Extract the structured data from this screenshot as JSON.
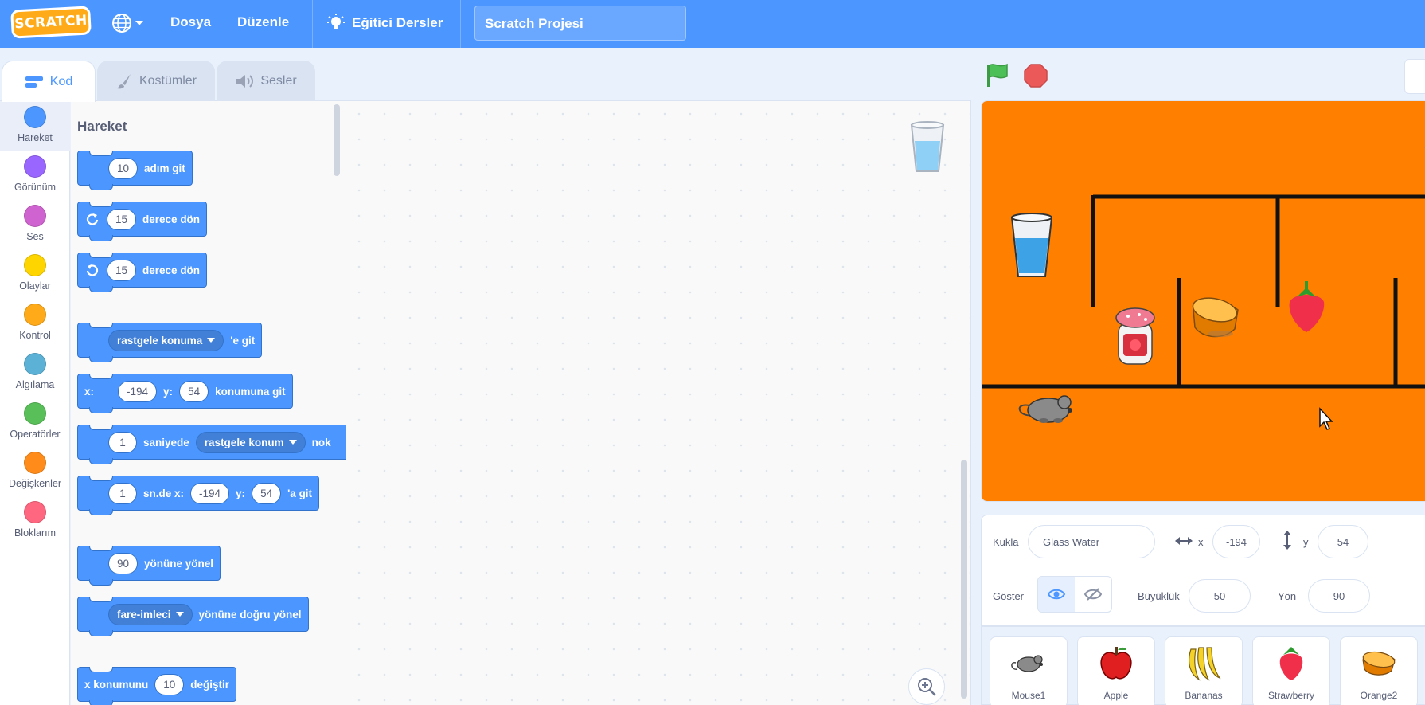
{
  "menubar": {
    "logo_text": "SCRATCH",
    "file": "Dosya",
    "edit": "Düzenle",
    "tutorials": "Eğitici Dersler",
    "project_title": "Scratch Projesi"
  },
  "tabs": {
    "code": "Kod",
    "costumes": "Kostümler",
    "sounds": "Sesler"
  },
  "categories": [
    {
      "label": "Hareket",
      "color": "#4c97ff"
    },
    {
      "label": "Görünüm",
      "color": "#9966ff"
    },
    {
      "label": "Ses",
      "color": "#cf63cf"
    },
    {
      "label": "Olaylar",
      "color": "#ffd500"
    },
    {
      "label": "Kontrol",
      "color": "#ffab19"
    },
    {
      "label": "Algılama",
      "color": "#5cb1d6"
    },
    {
      "label": "Operatörler",
      "color": "#59c059"
    },
    {
      "label": "Değişkenler",
      "color": "#ff8c1a"
    },
    {
      "label": "Bloklarım",
      "color": "#ff6680"
    }
  ],
  "palette": {
    "title": "Hareket",
    "b1": {
      "num": "10",
      "text": "adım git"
    },
    "b2": {
      "num": "15",
      "text": "derece dön"
    },
    "b3": {
      "num": "15",
      "text": "derece dön"
    },
    "b4": {
      "drop": "rastgele konuma",
      "text": "'e git"
    },
    "b5": {
      "x_label": "x:",
      "x": "-194",
      "y_label": "y:",
      "y": "54",
      "text": "konumuna git"
    },
    "b6": {
      "num": "1",
      "text1": "saniyede",
      "drop": "rastgele konum",
      "text2": "nok"
    },
    "b7": {
      "num": "1",
      "text1": "sn.de x:",
      "x": "-194",
      "y_label": "y:",
      "y": "54",
      "text2": "'a git"
    },
    "b8": {
      "num": "90",
      "text": "yönüne yönel"
    },
    "b9": {
      "drop": "fare-imleci",
      "text": "yönüne doğru yönel"
    },
    "b10": {
      "text1": "x konumunu",
      "num": "10",
      "text2": "değiştir"
    }
  },
  "sprite_info": {
    "sprite_label": "Kukla",
    "sprite_name": "Glass Water",
    "x_label": "x",
    "x": "-194",
    "y_label": "y",
    "y": "54",
    "show_label": "Göster",
    "size_label": "Büyüklük",
    "size": "50",
    "direction_label": "Yön",
    "direction": "90"
  },
  "sprites": [
    {
      "name": "Mouse1",
      "icon": "mouse-icon"
    },
    {
      "name": "Apple",
      "icon": "apple-icon"
    },
    {
      "name": "Bananas",
      "icon": "bananas-icon"
    },
    {
      "name": "Strawberry",
      "icon": "strawberry-icon"
    },
    {
      "name": "Orange2",
      "icon": "orange-icon"
    }
  ],
  "colors": {
    "menubar": "#4c97ff",
    "motion_block": "#4c97ff",
    "stage_background": "#ff8000",
    "green_flag": "#4cbf56",
    "stop": "#ec5959"
  }
}
